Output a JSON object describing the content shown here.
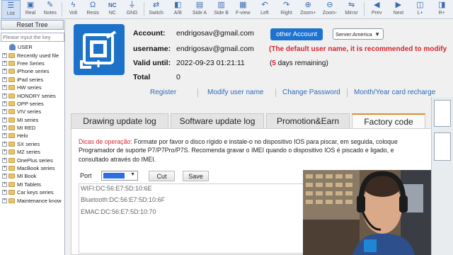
{
  "toolbar": {
    "items": [
      {
        "label": "List",
        "icon": "list-icon"
      },
      {
        "label": "Real",
        "icon": "real-icon"
      },
      {
        "label": "Notes",
        "icon": "notes-icon"
      },
      {
        "label": "Volt",
        "icon": "voltage-icon"
      },
      {
        "label": "Resis",
        "icon": "resistance-icon"
      },
      {
        "label": "NC",
        "icon": "nc-icon"
      },
      {
        "label": "GND",
        "icon": "ground-icon"
      },
      {
        "label": "Switch",
        "icon": "switch-icon"
      },
      {
        "label": "A/B",
        "icon": "ab-icon"
      },
      {
        "label": "Side A",
        "icon": "side-a-icon"
      },
      {
        "label": "Side B",
        "icon": "side-b-icon"
      },
      {
        "label": "F-view",
        "icon": "f-view-icon"
      },
      {
        "label": "Left",
        "icon": "rotate-left-icon"
      },
      {
        "label": "Right",
        "icon": "rotate-right-icon"
      },
      {
        "label": "Zoom+",
        "icon": "zoom-in-icon"
      },
      {
        "label": "Zoom-",
        "icon": "zoom-out-icon"
      },
      {
        "label": "Mirror",
        "icon": "mirror-icon"
      },
      {
        "label": "Prev",
        "icon": "prev-icon"
      },
      {
        "label": "Next",
        "icon": "next-icon"
      },
      {
        "label": "L+",
        "icon": "layer-plus-icon"
      },
      {
        "label": "R+",
        "icon": "r-plus-icon"
      }
    ],
    "nc_text": "NC"
  },
  "left_panel": {
    "reset_label": "Reset Tree",
    "search_placeholder": "Please input the key",
    "tree": [
      {
        "label": "USER",
        "type": "user"
      },
      {
        "label": "Recently used file",
        "type": "folder"
      },
      {
        "label": "Free Series",
        "type": "folder"
      },
      {
        "label": "iPhone series",
        "type": "folder"
      },
      {
        "label": "iPad series",
        "type": "folder"
      },
      {
        "label": "HW series",
        "type": "folder"
      },
      {
        "label": "HONORY series",
        "type": "folder"
      },
      {
        "label": "OPP series",
        "type": "folder"
      },
      {
        "label": "VIV series",
        "type": "folder"
      },
      {
        "label": "MI series",
        "type": "folder"
      },
      {
        "label": "MI RED",
        "type": "folder"
      },
      {
        "label": "Helo",
        "type": "folder"
      },
      {
        "label": "SX series",
        "type": "folder"
      },
      {
        "label": "MZ series",
        "type": "folder"
      },
      {
        "label": "OnePlus series",
        "type": "folder"
      },
      {
        "label": "MacBook series",
        "type": "folder"
      },
      {
        "label": "MI Book",
        "type": "folder"
      },
      {
        "label": "MI Tablets",
        "type": "folder"
      },
      {
        "label": "Car keys series",
        "type": "folder"
      },
      {
        "label": "Maintenance know",
        "type": "folder"
      }
    ]
  },
  "account": {
    "account_label": "Account:",
    "account_value": "endrigosav@gmail.com",
    "username_label": "username:",
    "username_value": "endrigosav@gmail.com",
    "valid_label": "Valid until:",
    "valid_value": "2022-09-23 01:21:11",
    "total_label": "Total",
    "total_value": "0",
    "other_account_btn": "other Account",
    "server_value": "Server:America",
    "warning": "(The default user name, it is recommended to modify",
    "days_prefix": "(",
    "days_number": "5",
    "days_suffix": " days remaining)"
  },
  "links": {
    "register": "Register",
    "modify_user": "Modify user name",
    "change_password": "Change Password",
    "recharge": "Month/Year card recharge"
  },
  "tabs": [
    {
      "label": "Drawing update log",
      "active": false
    },
    {
      "label": "Software update log",
      "active": false
    },
    {
      "label": "Promotion&Earn",
      "active": false
    },
    {
      "label": "Factory code",
      "active": true
    }
  ],
  "factory": {
    "desc_highlight": "Dicas de operação:",
    "desc_line1": " Formate por favor o disco rígido e instale-o no dispositivo IOS para piscar, em seguida, coloque",
    "desc_line2": "Programador de suporte P7/P7Pro/P7S. Recomenda gravar o IMEI quando o dispositivo IOS é piscado e ligado, e",
    "desc_line3": "consultado através do IMEI.",
    "port_label": "Port",
    "cut_label": "Cut",
    "save_label": "Save",
    "output": [
      "WIFI:DC:56:E7:5D:10:6E",
      "Bluetooth:DC:56:E7:5D:10:6F",
      "EMAC:DC:56:E7:5D:10:70"
    ]
  },
  "colors": {
    "accent": "#1e73cf",
    "warning": "#d6262e",
    "link": "#2f6bb5",
    "tab_active": "#e38b2a"
  }
}
